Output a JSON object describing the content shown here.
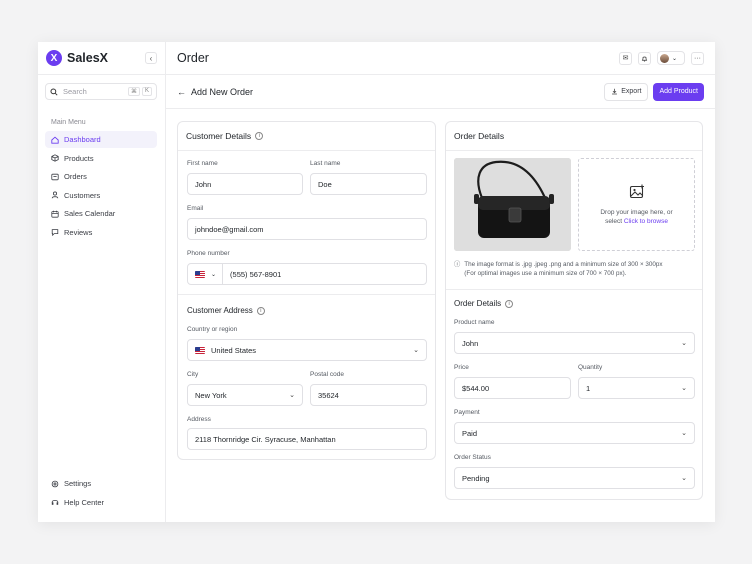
{
  "brand": {
    "logo_letter": "X",
    "name": "SalesX",
    "color": "#6b3df0"
  },
  "sidebar": {
    "search_placeholder": "Search",
    "shortcut": [
      "⌘",
      "K"
    ],
    "menu_title": "Main Menu",
    "items": [
      {
        "label": "Dashboard",
        "icon": "home-icon",
        "active": true
      },
      {
        "label": "Products",
        "icon": "box-icon"
      },
      {
        "label": "Orders",
        "icon": "orders-icon"
      },
      {
        "label": "Customers",
        "icon": "user-icon"
      },
      {
        "label": "Sales Calendar",
        "icon": "calendar-icon"
      },
      {
        "label": "Reviews",
        "icon": "reviews-icon"
      }
    ],
    "bottom": [
      {
        "label": "Settings",
        "icon": "gear-icon"
      },
      {
        "label": "Help Center",
        "icon": "headset-icon"
      }
    ]
  },
  "header": {
    "title": "Order"
  },
  "subheader": {
    "title": "Add New Order",
    "export_label": "Export",
    "add_label": "Add Product"
  },
  "customer": {
    "title": "Customer Details",
    "first_name_label": "First name",
    "first_name": "John",
    "last_name_label": "Last name",
    "last_name": "Doe",
    "email_label": "Email",
    "email": "johndoe@gmail.com",
    "phone_label": "Phone number",
    "phone": "(555) 567-8901"
  },
  "address": {
    "title": "Customer Address",
    "country_label": "Country or region",
    "country": "United States",
    "city_label": "City",
    "city": "New York",
    "postal_label": "Postal code",
    "postal": "35624",
    "address_label": "Address",
    "address": "2118 Thornridge Cir. Syracuse, Manhattan"
  },
  "order": {
    "title": "Order Details",
    "drop_text": "Drop your image here, or",
    "drop_select": "select",
    "drop_link": "Click to browse",
    "note_line1": "The image format is .jpg .jpeg .png and a minimum size of 300 × 300px",
    "note_line2": "(For optimal images use a minimum size of 700 × 700 px).",
    "details_title": "Order Details",
    "product_label": "Product name",
    "product": "John",
    "price_label": "Price",
    "price": "$544.00",
    "quantity_label": "Quantity",
    "quantity": "1",
    "payment_label": "Payment",
    "payment": "Paid",
    "status_label": "Order Status",
    "status": "Pending"
  }
}
